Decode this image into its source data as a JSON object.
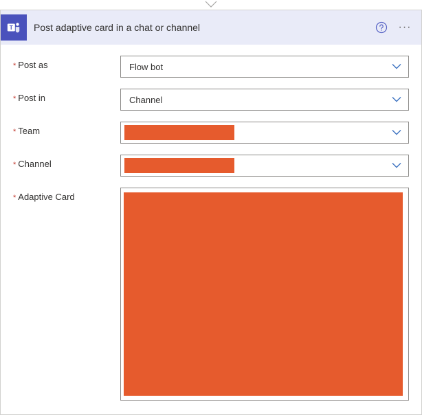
{
  "connector": "down",
  "header": {
    "title": "Post adaptive card in a chat or channel",
    "icon": "teams-icon"
  },
  "fields": {
    "postAs": {
      "label": "Post as",
      "value": "Flow bot",
      "required": true
    },
    "postIn": {
      "label": "Post in",
      "value": "Channel",
      "required": true
    },
    "team": {
      "label": "Team",
      "value": "",
      "required": true,
      "redacted": true
    },
    "channel": {
      "label": "Channel",
      "value": "",
      "required": true,
      "redacted": true
    },
    "adaptiveCard": {
      "label": "Adaptive Card",
      "value": "",
      "required": true,
      "redacted": true
    }
  },
  "colors": {
    "accent": "#4a52bc",
    "redaction": "#e65b2d",
    "chevron": "#3a70c0"
  }
}
